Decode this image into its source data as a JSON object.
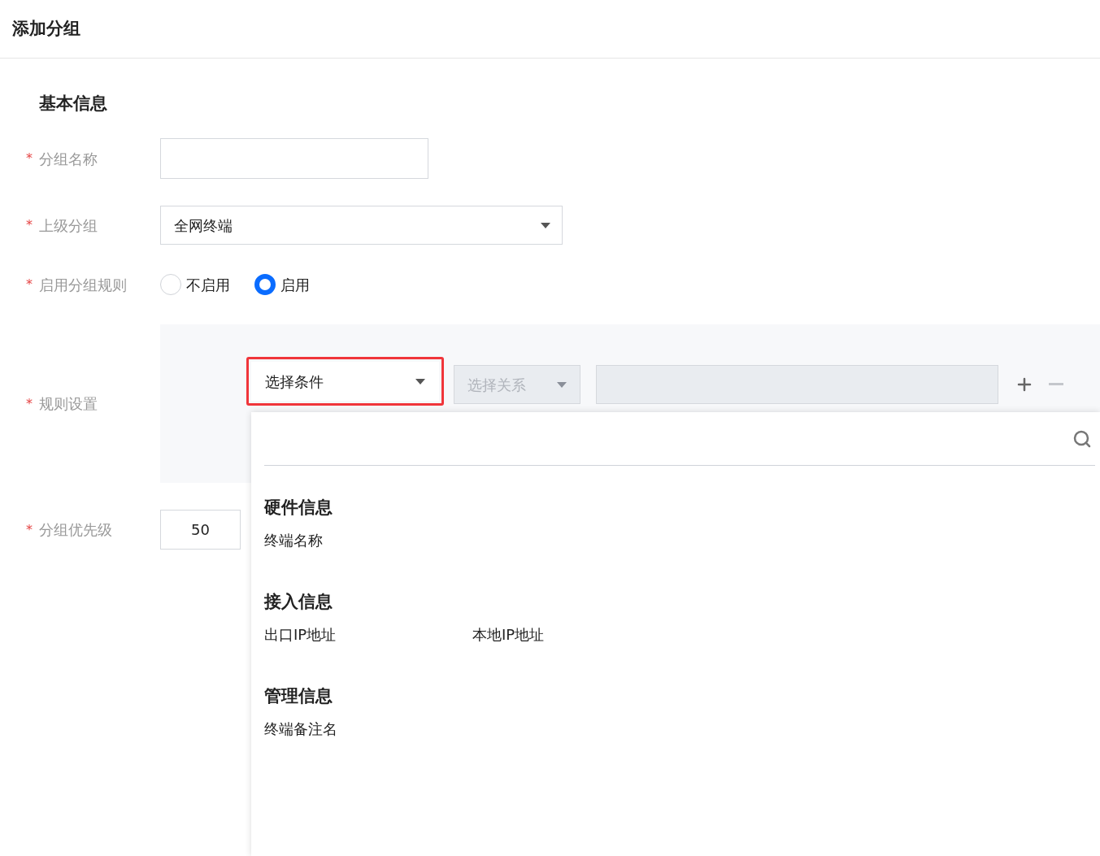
{
  "header": {
    "title": "添加分组"
  },
  "section_title": "基本信息",
  "group_name": {
    "label": "分组名称",
    "required_mark": "*"
  },
  "parent_group": {
    "label": "上级分组",
    "required_mark": "*",
    "value": "全网终端"
  },
  "enable_rules": {
    "label": "启用分组规则",
    "required_mark": "*",
    "options": [
      {
        "label": "不启用",
        "selected": false
      },
      {
        "label": "启用",
        "selected": true
      }
    ]
  },
  "rules": {
    "label": "规则设置",
    "required_mark": "*",
    "condition": {
      "placeholder": "选择条件",
      "highlighted": true,
      "expanded": true
    },
    "relation": {
      "placeholder": "选择关系",
      "disabled": true
    },
    "value": {
      "disabled": true
    },
    "remove_disabled": true
  },
  "priority": {
    "label": "分组优先级",
    "required_mark": "*",
    "value": "50"
  },
  "dropdown": {
    "groups": [
      {
        "title": "硬件信息",
        "items": [
          "终端名称"
        ]
      },
      {
        "title": "接入信息",
        "items": [
          "出口IP地址",
          "本地IP地址"
        ]
      },
      {
        "title": "管理信息",
        "items": [
          "终端备注名"
        ]
      }
    ]
  }
}
